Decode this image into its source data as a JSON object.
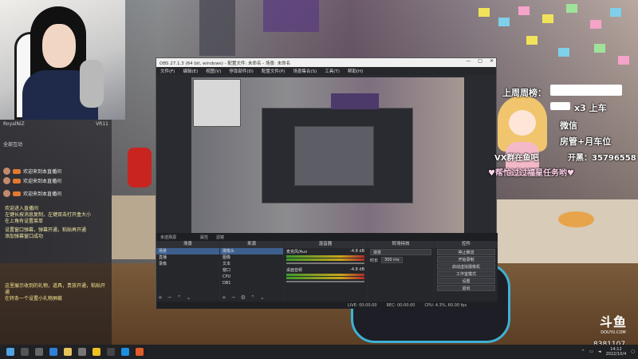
{
  "overlay": {
    "line1": "上周周榜：",
    "line2": "x3 上车",
    "line3": "微信",
    "line4": "房管+月车位",
    "line5": "VX群在鱼吧",
    "line6": "开黑：35796558",
    "line7": "♥帮忙过过福星任务哟♥"
  },
  "chat": {
    "top_left": "RoyalNiZ",
    "top_mid": "VR11",
    "header": "全部互动",
    "messages": [
      {
        "text": "欢迎来到本直播间"
      },
      {
        "text": "欢迎来到本直播间"
      },
      {
        "text": "欢迎来到本直播间"
      }
    ],
    "notice1": "欢迎进入直播间\n左键长按消息复制，左键双击打开盒大小\n在上角有设置菜单",
    "notice2": "设置窗口弹幕，弹幕开通，粘贴再开通\n添加弹幕窗口成功",
    "notice3": "这里展示收到的礼物，道具，贵族开通，粘贴开\n通\n在转条一个设置小礼物屏蔽"
  },
  "obs": {
    "title": "OBS 27.1.3 (64 bit, windows) - 配置文件: 未命名 - 场景: 未命名",
    "menu": [
      "文件(F)",
      "编辑(E)",
      "视图(V)",
      "停靠部件(D)",
      "配置文件(P)",
      "场景集合(S)",
      "工具(T)",
      "帮助(H)"
    ],
    "status_strip": [
      "未选择源",
      "属性",
      "滤镜"
    ],
    "scenes_header": "场景",
    "scenes": [
      "场景",
      "直播",
      "录像"
    ],
    "sources_header": "来源",
    "sources": [
      "摄像头",
      "图像",
      "文本",
      "窗口",
      "CPU",
      "DB1"
    ],
    "mixer_header": "混音器",
    "mixer_tracks": [
      {
        "name": "麦克风/Aux",
        "db": "-4.8 dB"
      },
      {
        "name": "桌面音频",
        "db": "-4.8 dB"
      }
    ],
    "transitions_header": "转场特效",
    "transition_type": "渐变",
    "transition_duration_label": "时长",
    "transition_duration": "300 ms",
    "controls_header": "控件",
    "controls": [
      "停止推流",
      "开始录制",
      "启动虚拟摄像机",
      "工作室模式",
      "设置",
      "退出"
    ],
    "footer": [
      "LIVE: 00:00:00",
      "REC: 00:00:00",
      "CPU: 4.3%, 60.00 fps"
    ]
  },
  "douyu": {
    "logo": "斗鱼",
    "url": "DOUYU.COM"
  },
  "room_id": "8381107",
  "tray": {
    "time": "14:12",
    "date": "2022/10/4"
  }
}
